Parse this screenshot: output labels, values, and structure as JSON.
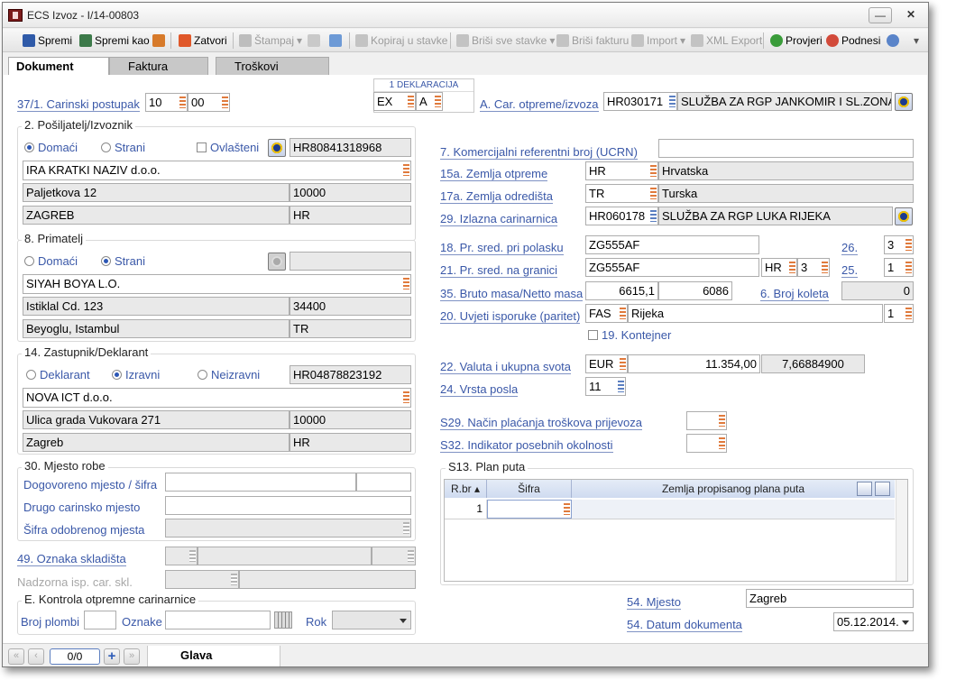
{
  "window": {
    "title": "ECS Izvoz - I/14-00803",
    "minimize": "—",
    "close": "✕"
  },
  "toolbar": {
    "spremi": "Spremi",
    "spremi_kao": "Spremi kao",
    "zatvori": "Zatvori",
    "stampaj": "Štampaj",
    "kopiraj": "Kopiraj u stavke",
    "brisi_sve": "Briši sve stavke",
    "brisi_fakturu": "Briši fakturu",
    "import": "Import",
    "xml_export": "XML Export",
    "provjeri": "Provjeri",
    "podnesi": "Podnesi"
  },
  "tabs": [
    "Dokument",
    "Faktura",
    "Troškovi"
  ],
  "f37": {
    "label": "37/1. Carinski postupak",
    "code1": "10",
    "code2": "00"
  },
  "deklaracija": {
    "header": "1 DEKLARACIJA",
    "v1": "EX",
    "v2": "A"
  },
  "carotpreme": {
    "label": "A. Car. otpreme/izvoza",
    "code": "HR030171",
    "name": "SLUŽBA ZA RGP JANKOMIR I SL.ZONA"
  },
  "posiljatelj": {
    "title": "2. Pošiljatelj/Izvoznik",
    "domaci": "Domaći",
    "strani": "Strani",
    "ovlasteni": "Ovlašteni",
    "oib": "HR80841318968",
    "naziv": "IRA KRATKI NAZIV d.o.o.",
    "adresa": "Paljetkova 12",
    "posta": "10000",
    "mjesto": "ZAGREB",
    "drzava": "HR"
  },
  "primatelj": {
    "title": "8. Primatelj",
    "domaci": "Domaći",
    "strani": "Strani",
    "naziv": "SIYAH BOYA L.O.",
    "adresa": "Istiklal Cd. 123",
    "posta": "34400",
    "mjesto": "Beyoglu, Istambul",
    "drzava": "TR"
  },
  "zastupnik": {
    "title": "14. Zastupnik/Deklarant",
    "deklarant": "Deklarant",
    "izravni": "Izravni",
    "neizravni": "Neizravni",
    "oib": "HR04878823192",
    "naziv": "NOVA ICT d.o.o.",
    "adresa": "Ulica grada Vukovara 271",
    "posta": "10000",
    "mjesto": "Zagreb",
    "drzava": "HR"
  },
  "mjesto_robe": {
    "title": "30. Mjesto robe",
    "dogovoreno": "Dogovoreno mjesto / šifra",
    "drugo": "Drugo carinsko mjesto",
    "sifra_odobrenog": "Šifra odobrenog mjesta"
  },
  "skladiste": {
    "label": "49. Oznaka skladišta",
    "nadzorna": "Nadzorna isp. car. skl."
  },
  "kontrola": {
    "title": "E. Kontrola otpremne carinarnice",
    "broj_plombi": "Broj plombi",
    "oznake": "Oznake",
    "rok": "Rok"
  },
  "right": {
    "ucrn_label": "7. Komercijalni referentni broj (UCRN)",
    "zemlja_otpreme_label": "15a. Zemlja otpreme",
    "zemlja_otpreme_code": "HR",
    "zemlja_otpreme_name": "Hrvatska",
    "zemlja_odredista_label": "17a. Zemlja odredišta",
    "zemlja_odredista_code": "TR",
    "zemlja_odredista_name": "Turska",
    "izlazna_label": "29. Izlazna carinarnica",
    "izlazna_code": "HR060178",
    "izlazna_name": "SLUŽBA ZA RGP LUKA RIJEKA",
    "pr_polasku_label": "18. Pr. sred. pri polasku",
    "pr_polasku": "ZG555AF",
    "f26_label": "26.",
    "f26": "3",
    "pr_granici_label": "21. Pr. sred. na granici",
    "pr_granici": "ZG555AF",
    "pr_granici_drz": "HR",
    "pr_granici_num": "3",
    "f25_label": "25.",
    "f25": "1",
    "bruto_label": "35. Bruto masa/Netto masa",
    "bruto": "6615,1",
    "netto": "6086",
    "koleta_label": "6. Broj koleta",
    "koleta": "0",
    "uvjeti_label": "20. Uvjeti isporuke (paritet)",
    "uvjeti_code": "FAS",
    "uvjeti_mjesto": "Rijeka",
    "uvjeti_num": "1",
    "kontejner_label": "19. Kontejner",
    "valuta_label": "22. Valuta i ukupna svota",
    "valuta": "EUR",
    "svota": "11.354,00",
    "tecaj": "7,66884900",
    "vrsta_label": "24. Vrsta posla",
    "vrsta": "11",
    "s29_label": "S29. Način plaćanja troškova prijevoza",
    "s32_label": "S32. Indikator posebnih okolnosti",
    "s13_title": "S13. Plan puta",
    "col_rbr": "R.br",
    "col_sifra": "Šifra",
    "col_zemlja": "Zemlja propisanog plana puta",
    "row_rbr": "1",
    "mjesto_label": "54. Mjesto",
    "mjesto": "Zagreb",
    "datum_label": "54. Datum dokumenta",
    "datum": "05.12.2014."
  },
  "bottom": {
    "counter": "0/0",
    "tab": "Glava"
  }
}
